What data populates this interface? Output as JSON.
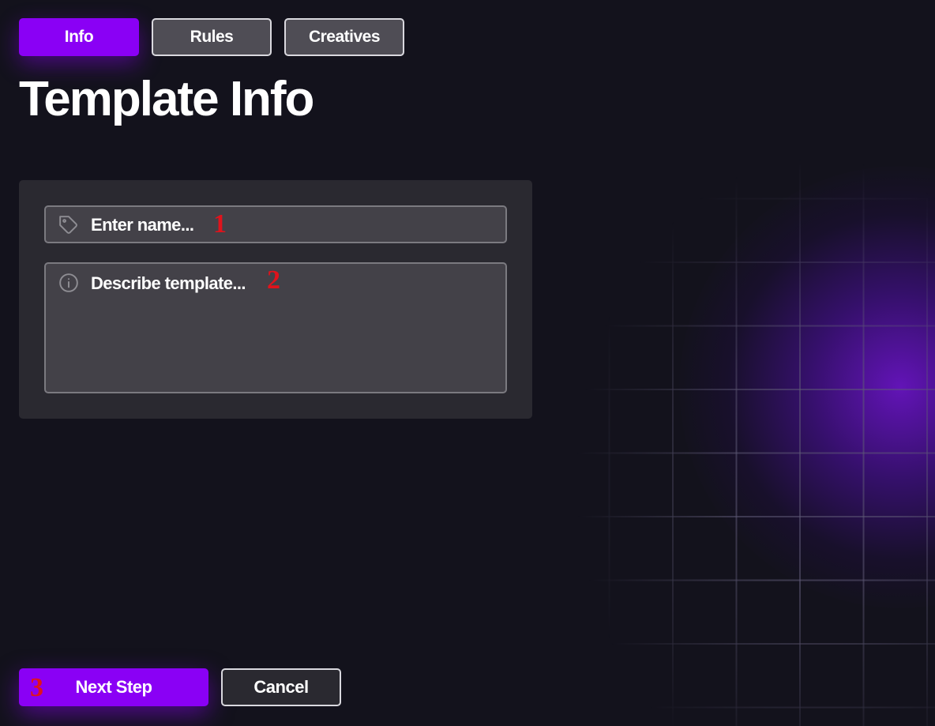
{
  "tabs": [
    {
      "label": "Info",
      "active": true
    },
    {
      "label": "Rules",
      "active": false
    },
    {
      "label": "Creatives",
      "active": false
    }
  ],
  "page_title": "Template Info",
  "form": {
    "name_field": {
      "placeholder": "Enter name...",
      "icon": "tag-icon",
      "marker": "1"
    },
    "description_field": {
      "placeholder": "Describe template...",
      "icon": "info-icon",
      "marker": "2"
    }
  },
  "actions": {
    "next_label": "Next Step",
    "next_marker": "3",
    "cancel_label": "Cancel"
  },
  "colors": {
    "background": "#13121c",
    "accent": "#8a00f5",
    "card": "#2a2930",
    "field": "#434148",
    "marker": "#e0131c"
  }
}
